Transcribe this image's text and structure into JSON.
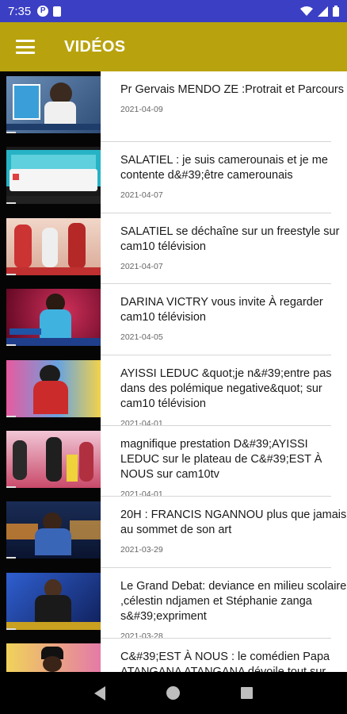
{
  "status_bar": {
    "time": "7:35",
    "icons": [
      "p-icon",
      "sd-card-icon",
      "wifi-icon",
      "signal-icon",
      "battery-icon"
    ]
  },
  "app_bar": {
    "title": "VIDÉOS",
    "color": "#b8a30f"
  },
  "videos": [
    {
      "title": "Pr Gervais MENDO ZE :Protrait et Parcours",
      "date": "2021-04-09"
    },
    {
      "title": "SALATIEL : je suis camerounais et je me contente d&#39;être camerounais",
      "date": "2021-04-07"
    },
    {
      "title": "SALATIEL se déchaîne sur un freestyle sur cam10 télévision",
      "date": "2021-04-07"
    },
    {
      "title": "DARINA VICTRY  vous invite À regarder cam10 télévision",
      "date": "2021-04-05"
    },
    {
      "title": "AYISSI LEDUC &quot;je n&#39;entre pas dans des polémique negative&quot; sur cam10 télévision",
      "date": "2021-04-01"
    },
    {
      "title": "magnifique  prestation D&#39;AYISSI LEDUC sur le plateau de C&#39;EST À NOUS sur cam10tv",
      "date": "2021-04-01"
    },
    {
      "title": "20H : FRANCIS NGANNOU plus que jamais au sommet de son art",
      "date": "2021-03-29"
    },
    {
      "title": "Le Grand Debat: deviance en milieu scolaire ,célestin ndjamen et Stéphanie zanga s&#39;expriment",
      "date": "2021-03-28"
    },
    {
      "title": "C&#39;EST À NOUS : le comédien Papa ATANGANA ATANGANA dévoile tout sur",
      "date": ""
    }
  ]
}
